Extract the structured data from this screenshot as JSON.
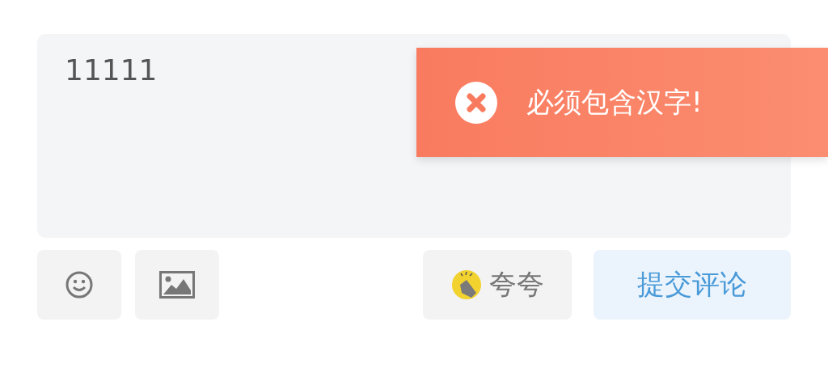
{
  "comment_box": {
    "value": "11111"
  },
  "toolbar": {
    "praise_button": {
      "label": "夸夸"
    },
    "submit_button": {
      "label": "提交评论"
    }
  },
  "toast": {
    "kind": "error",
    "message": "必须包含汉字!"
  }
}
